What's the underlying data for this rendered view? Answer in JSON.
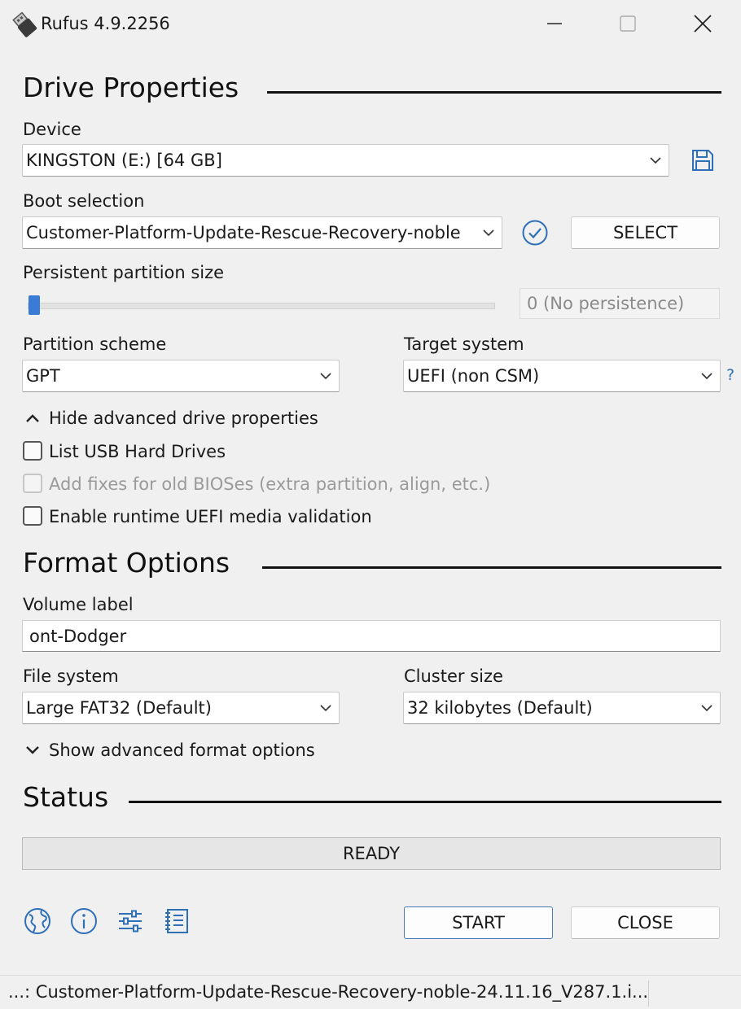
{
  "window": {
    "title": "Rufus 4.9.2256",
    "controls": [
      "minimize",
      "maximize",
      "close"
    ]
  },
  "drive_properties": {
    "heading": "Drive Properties",
    "device": {
      "label": "Device",
      "value": "KINGSTON (E:) [64 GB]"
    },
    "boot_selection": {
      "label": "Boot selection",
      "value": "Customer-Platform-Update-Rescue-Recovery-noble",
      "select_button": "SELECT"
    },
    "persistent": {
      "label": "Persistent partition size",
      "value": "0 (No persistence)",
      "slider_fraction": 0
    },
    "partition_scheme": {
      "label": "Partition scheme",
      "value": "GPT"
    },
    "target_system": {
      "label": "Target system",
      "value": "UEFI (non CSM)",
      "help": "?"
    },
    "advanced_toggle": "Hide advanced drive properties",
    "options": [
      {
        "label": "List USB Hard Drives",
        "checked": false,
        "enabled": true
      },
      {
        "label": "Add fixes for old BIOSes (extra partition, align, etc.)",
        "checked": false,
        "enabled": false
      },
      {
        "label": "Enable runtime UEFI media validation",
        "checked": false,
        "enabled": true
      }
    ]
  },
  "format_options": {
    "heading": "Format Options",
    "volume_label": {
      "label": "Volume label",
      "value": "ont-Dodger"
    },
    "file_system": {
      "label": "File system",
      "value": "Large FAT32 (Default)"
    },
    "cluster_size": {
      "label": "Cluster size",
      "value": "32 kilobytes (Default)"
    },
    "advanced_toggle": "Show advanced format options"
  },
  "status": {
    "heading": "Status",
    "state": "READY"
  },
  "footer": {
    "icons": [
      "globe-icon",
      "info-icon",
      "settings-sliders-icon",
      "log-icon"
    ],
    "start": "START",
    "close": "CLOSE"
  },
  "statusline": {
    "text": "...: Customer-Platform-Update-Rescue-Recovery-noble-24.11.16_V287.1.i..."
  },
  "colors": {
    "accent": "#3a7bd5",
    "background": "#f0f0f0"
  }
}
